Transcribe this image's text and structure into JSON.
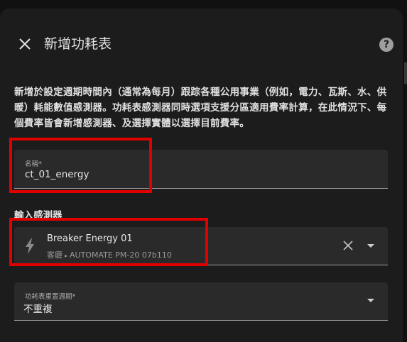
{
  "dialog": {
    "title": "新增功耗表",
    "description": "新增於設定週期時間內（通常為每月）跟踪各種公用事業（例如，電力、瓦斯、水、供暖）耗能數值感測器。功耗表感測器同時選項支援分區適用費率計算，在此情況下、每個費率皆會新增感測器、及選擇實體以選擇目前費率。",
    "icons": {
      "close": "close-icon",
      "help": "help-icon"
    }
  },
  "name_field": {
    "label": "名稱*",
    "value": "ct_01_energy"
  },
  "input_sensor": {
    "section_label": "輸入感測器",
    "entity_name": "Breaker Energy 01",
    "area": "客廳",
    "device": "AUTOMATE PM-20 07b110",
    "icons": {
      "entity": "lightning-bolt-icon",
      "clear": "clear-icon",
      "dropdown": "chevron-down-icon"
    }
  },
  "reset_cycle": {
    "label": "功耗表重置週期*",
    "value": "不重複",
    "icons": {
      "dropdown": "chevron-down-icon"
    }
  },
  "annotations": {
    "highlight_color": "#e00000"
  },
  "colors": {
    "dialog_bg": "#1c1c1c",
    "field_bg": "#2a2a2a",
    "text": "#e1e1e1"
  }
}
